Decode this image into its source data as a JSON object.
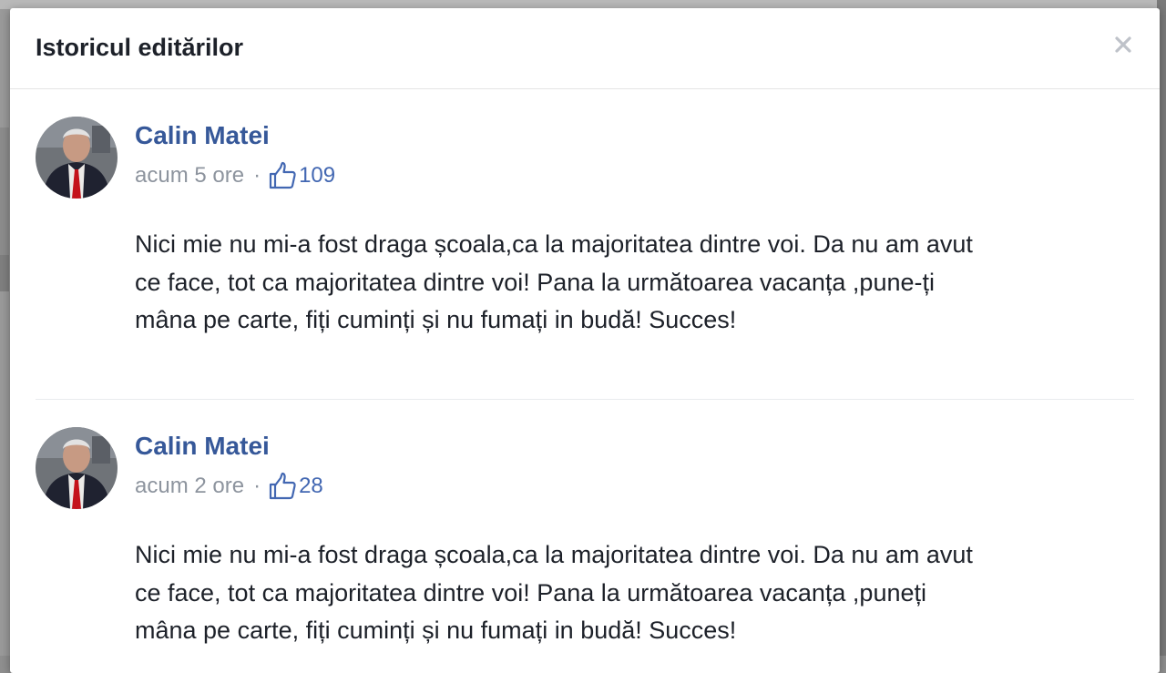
{
  "dialog": {
    "title": "Istoricul editărilor",
    "close_symbol": "×"
  },
  "entries": [
    {
      "author": "Calin Matei",
      "time": "acum 5 ore",
      "separator": "·",
      "likes": "109",
      "lines": [
        "Nici mie nu mi-a fost draga școala,ca la majoritatea dintre voi. Da nu am avut",
        "ce face, tot ca majoritatea dintre voi! Pana la următoarea vacanța ,pune-ți",
        "mâna pe carte, fiți cuminți și nu fumați in budă! Succes!"
      ]
    },
    {
      "author": "Calin Matei",
      "time": "acum 2 ore",
      "separator": "·",
      "likes": "28",
      "lines": [
        "Nici mie nu mi-a fost draga școala,ca la majoritatea dintre voi. Da nu am avut",
        "ce face, tot ca majoritatea dintre voi! Pana la următoarea vacanța ,puneți",
        "mâna pe carte, fiți cuminți și nu fumați in budă! Succes!"
      ]
    }
  ],
  "icons": {
    "close": "close-icon",
    "like": "thumbs-up-icon",
    "avatar": "avatar-photo"
  },
  "colors": {
    "link": "#365899",
    "like": "#4267b2",
    "meta": "#8d949e",
    "text": "#1d2129"
  }
}
